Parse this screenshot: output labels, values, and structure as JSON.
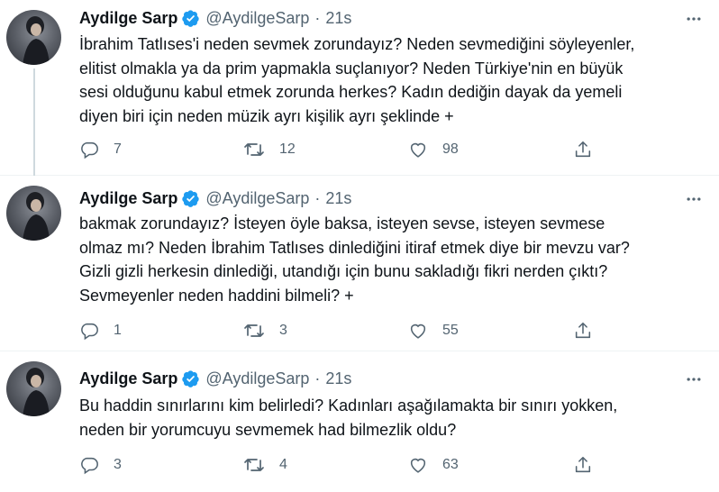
{
  "tweets": [
    {
      "author": "Aydilge Sarp",
      "handle": "@AydilgeSarp",
      "separator": "·",
      "time": "21s",
      "text": "İbrahim Tatlıses'i neden sevmek zorundayız? Neden sevmediğini söyleyenler,\nelitist olmakla ya da prim yapmakla suçlanıyor? Neden Türkiye'nin en büyük\nsesi olduğunu kabul etmek zorunda herkes? Kadın dediğin dayak da yemeli\ndiyen biri için neden müzik ayrı kişilik ayrı şeklinde +",
      "replies": "7",
      "retweets": "12",
      "likes": "98"
    },
    {
      "author": "Aydilge Sarp",
      "handle": "@AydilgeSarp",
      "separator": "·",
      "time": "21s",
      "text": "bakmak zorundayız? İsteyen öyle baksa, isteyen sevse, isteyen sevmese\nolmaz mı? Neden İbrahim Tatlıses dinlediğini itiraf etmek diye bir mevzu var?\nGizli gizli herkesin dinlediği, utandığı için bunu sakladığı fikri nerden çıktı?\nSevmeyenler neden haddini bilmeli? +",
      "replies": "1",
      "retweets": "3",
      "likes": "55"
    },
    {
      "author": "Aydilge Sarp",
      "handle": "@AydilgeSarp",
      "separator": "·",
      "time": "21s",
      "text": "Bu haddin sınırlarını kim belirledi? Kadınları aşağılamakta bir sınırı yokken,\nneden bir yorumcuyu sevmemek had bilmezlik oldu?",
      "replies": "3",
      "retweets": "4",
      "likes": "63"
    }
  ],
  "colors": {
    "text": "#0f1419",
    "secondary": "#536471",
    "verified": "#1d9bf0",
    "thread_line": "#cfd9de"
  },
  "icons": {
    "verified": "verified-badge-icon",
    "more": "more-icon",
    "reply": "reply-icon",
    "retweet": "retweet-icon",
    "like": "like-icon",
    "share": "share-icon"
  }
}
